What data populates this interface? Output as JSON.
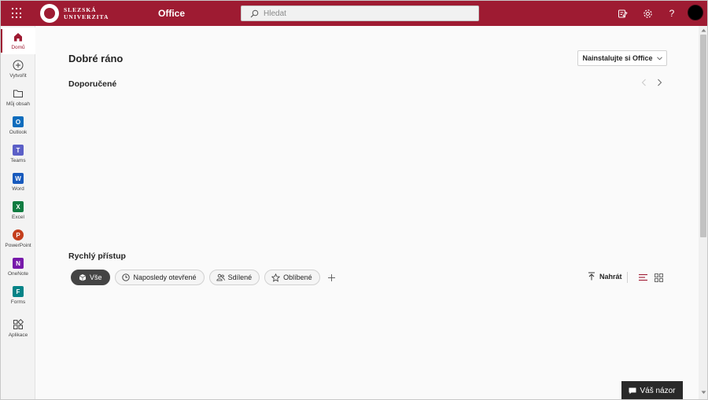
{
  "header": {
    "brand_line1": "SLEZSKÁ",
    "brand_line2": "UNIVERZITA",
    "app_name": "Office",
    "search_placeholder": "Hledat",
    "icons": [
      "waffle-icon",
      "search-icon",
      "whats-new-icon",
      "settings-icon",
      "help-icon",
      "avatar"
    ],
    "accent_color": "#9e1b32"
  },
  "rail": {
    "items": [
      {
        "label": "Domů",
        "icon": "home-icon",
        "active": true
      },
      {
        "label": "Vytvořit",
        "icon": "create-icon"
      },
      {
        "label": "Můj obsah",
        "icon": "folder-icon"
      },
      {
        "label": "Outlook",
        "icon": "outlook-icon",
        "letter": "O",
        "color": "#0f6cbd"
      },
      {
        "label": "Teams",
        "icon": "teams-icon",
        "letter": "T",
        "color": "#5b5fc7"
      },
      {
        "label": "Word",
        "icon": "word-icon",
        "letter": "W",
        "color": "#185abd"
      },
      {
        "label": "Excel",
        "icon": "excel-icon",
        "letter": "X",
        "color": "#107c41"
      },
      {
        "label": "PowerPoint",
        "icon": "powerpoint-icon",
        "letter": "P",
        "color": "#c43e1c"
      },
      {
        "label": "OneNote",
        "icon": "onenote-icon",
        "letter": "N",
        "color": "#7719aa"
      },
      {
        "label": "Forms",
        "icon": "forms-icon",
        "letter": "F",
        "color": "#038387"
      },
      {
        "label": "Aplikace",
        "icon": "apps-icon"
      }
    ]
  },
  "main": {
    "greeting": "Dobré ráno",
    "install_button": "Nainstalujte si Office",
    "recommended_title": "Doporučené",
    "quick_access_title": "Rychlý přístup",
    "filters": [
      {
        "label": "Vše",
        "icon": "cube-icon",
        "selected": true
      },
      {
        "label": "Naposledy otevřené",
        "icon": "clock-icon"
      },
      {
        "label": "Sdílené",
        "icon": "people-icon"
      },
      {
        "label": "Oblíbené",
        "icon": "star-icon"
      }
    ],
    "upload_label": "Nahrát",
    "feedback_label": "Váš názor"
  }
}
